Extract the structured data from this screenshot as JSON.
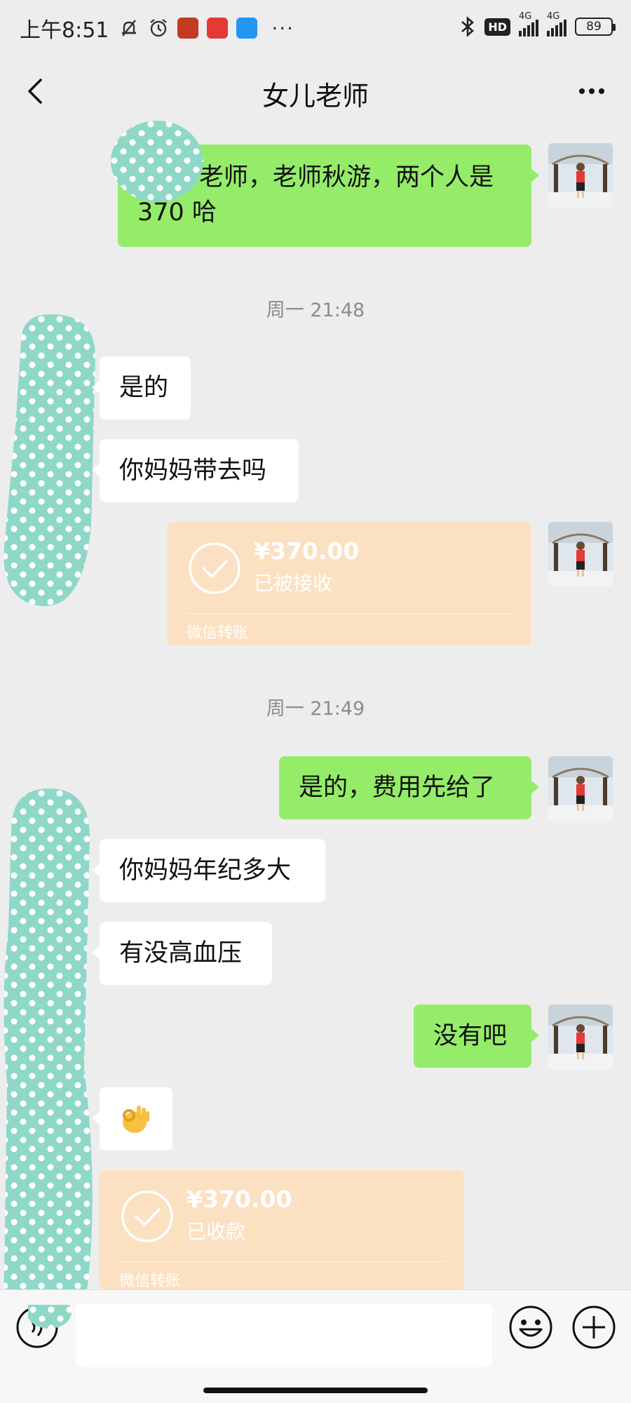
{
  "status_bar": {
    "time": "上午8:51",
    "hd_badge": "HD",
    "network_1": "4G",
    "network_2": "4G",
    "battery": "89",
    "app_icons": [
      {
        "name": "notification-off-icon"
      },
      {
        "name": "alarm-icon"
      },
      {
        "name": "music-app-icon",
        "color": "#c23b22"
      },
      {
        "name": "news-app-icon",
        "color": "#e53935"
      },
      {
        "name": "messenger-app-icon",
        "color": "#2196f3"
      }
    ]
  },
  "nav": {
    "title": "女儿老师",
    "back_icon": "chevron-left-icon",
    "more_icon": "more-dots-icon"
  },
  "messages": [
    {
      "side": "right",
      "type": "text",
      "text": "老师，老师秋游，两个人是370哈",
      "line1": "老师，老师秋游，两个人是",
      "line2": "370 哈"
    },
    {
      "type": "timestamp",
      "text": "周一 21:48"
    },
    {
      "side": "left",
      "type": "text",
      "text": "是的"
    },
    {
      "side": "left",
      "type": "text",
      "text": "你妈妈带去吗"
    },
    {
      "side": "right",
      "type": "transfer",
      "amount": "¥370.00",
      "status": "已被接收",
      "source": "微信转账"
    },
    {
      "type": "timestamp",
      "text": "周一 21:49"
    },
    {
      "side": "right",
      "type": "text",
      "text": "是的，费用先给了"
    },
    {
      "side": "left",
      "type": "text",
      "text": "你妈妈年纪多大"
    },
    {
      "side": "left",
      "type": "text",
      "text": "有没高血压"
    },
    {
      "side": "right",
      "type": "text",
      "text": "没有吧"
    },
    {
      "side": "left",
      "type": "emoji",
      "text": "👌"
    },
    {
      "side": "left",
      "type": "transfer",
      "amount": "¥370.00",
      "status": "已收款",
      "source": "微信转账"
    }
  ],
  "input_bar": {
    "placeholder": "",
    "voice_icon": "voice-icon",
    "emoji_icon": "emoji-icon",
    "plus_icon": "plus-icon"
  },
  "colors": {
    "background": "#ededed",
    "sent_bubble": "#95ec69",
    "received_bubble": "#ffffff",
    "transfer_card": "#fce0c2",
    "redaction": "#8fd8c8"
  }
}
